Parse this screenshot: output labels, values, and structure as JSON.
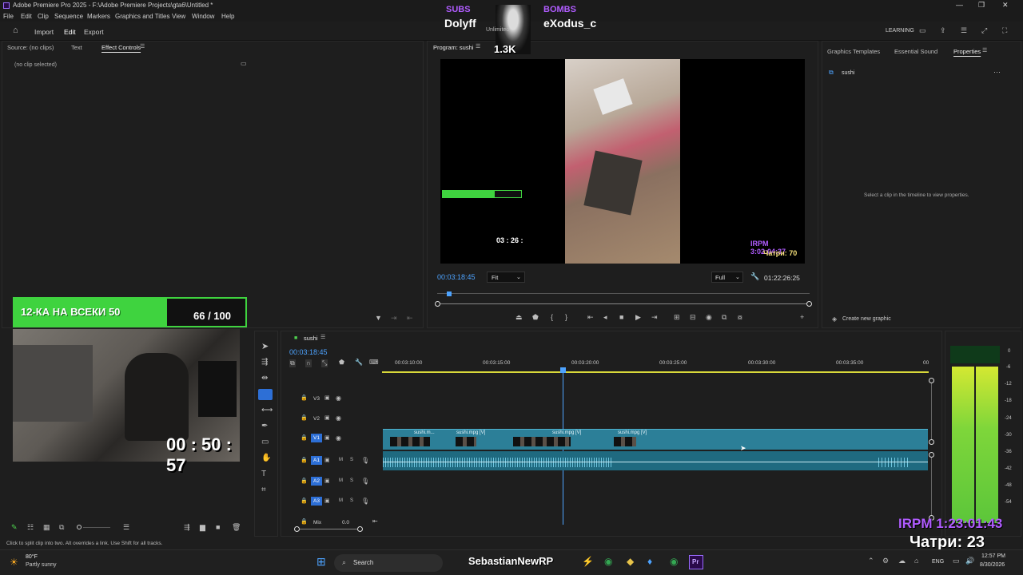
{
  "app": {
    "title": "Adobe Premiere Pro 2025 - F:\\Adobe Premiere Projects\\gta6\\Untitled *",
    "menu": [
      "File",
      "Edit",
      "Clip",
      "Sequence",
      "Markers",
      "Graphics and Titles",
      "View",
      "Window",
      "Help"
    ],
    "workspace_tabs": [
      "Import",
      "Edit",
      "Export"
    ],
    "learning": "LEARNING"
  },
  "source_panel": {
    "tabs": [
      "Source: (no clips)",
      "Text",
      "Effect Controls"
    ],
    "no_clip": "(no clip selected)"
  },
  "program": {
    "tab": "Program: sushi",
    "timecode": "00:03:18:45",
    "fit": "Fit",
    "full": "Full",
    "duration": "01:22:26:25"
  },
  "properties_panel": {
    "tabs": [
      "Graphics Templates",
      "Essential Sound",
      "Properties"
    ],
    "item": "sushi",
    "hint": "Select a clip in the timeline to view properties.",
    "create": "Create new graphic"
  },
  "timeline": {
    "tab": "sushi",
    "timecode": "00:03:18:45",
    "ruler": [
      "00:03:10:00",
      "00:03:15:00",
      "00:03:20:00",
      "00:03:25:00",
      "00:03:30:00",
      "00:03:35:00",
      "00"
    ],
    "tracks": [
      "V3",
      "V2",
      "V1",
      "A1",
      "A2",
      "A3"
    ],
    "mix": "Mix",
    "mix_value": "0.0",
    "clips": [
      "sushi.m...",
      "sushi.mpg [V]",
      "sushi.mpg [V]",
      "sushi.mpg [V]"
    ]
  },
  "meter_scale": [
    "0",
    "-6",
    "-12",
    "-18",
    "-24",
    "-30",
    "-36",
    "-42",
    "-48",
    "-54"
  ],
  "status": "Click to split clip into two. Alt overrides a link. Use Shift for all tracks.",
  "overlays": {
    "subs_label": "SUBS",
    "subs_name": "Dolyff",
    "bombs_label": "BOMBS",
    "bombs_name": "eXodus_c",
    "unlimited": "Unlimited",
    "count": "1.3K",
    "goal_text": "12-КА НА ВСЕКИ 50",
    "goal_value": "66 / 100",
    "goal_fraction": 0.66,
    "webcam_timer": "00 : 50 : 57",
    "irpm": "IRPM 1:23:01:43",
    "chatri": "Чатри: 23",
    "preview_irpm": "IRPM 3:02:04:37",
    "preview_chatri": "Чатри: 70",
    "preview_timer": "03 : 26 :"
  },
  "taskbar": {
    "weather_temp": "80°F",
    "weather_desc": "Partly sunny",
    "search": "Search",
    "streamer": "SebastianNewRP",
    "lang": "ENG",
    "time": "12:57 PM",
    "date": "8/30/2026"
  },
  "colors": {
    "accent": "#2c7f98",
    "playhead": "#4da3ff",
    "goal_green": "#3fd33f",
    "overlay_purple": "#b05cff"
  }
}
